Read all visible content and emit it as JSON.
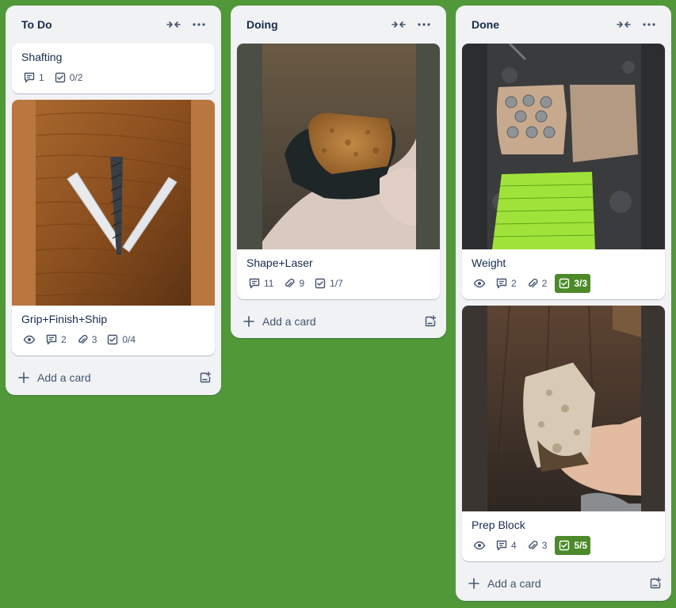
{
  "lists": [
    {
      "title": "To Do",
      "cards": [
        {
          "title": "Shafting",
          "comments": "1",
          "checklist": "0/2"
        },
        {
          "title": "Grip+Finish+Ship",
          "comments": "2",
          "attachments": "3",
          "checklist": "0/4"
        }
      ],
      "add_label": "Add a card"
    },
    {
      "title": "Doing",
      "cards": [
        {
          "title": "Shape+Laser",
          "comments": "11",
          "attachments": "9",
          "checklist": "1/7"
        }
      ],
      "add_label": "Add a card"
    },
    {
      "title": "Done",
      "cards": [
        {
          "title": "Weight",
          "comments": "2",
          "attachments": "2",
          "checklist": "3/3"
        },
        {
          "title": "Prep Block",
          "comments": "4",
          "attachments": "3",
          "checklist": "5/5"
        }
      ],
      "add_label": "Add a card"
    }
  ],
  "colors": {
    "board_background": "#519839",
    "list_background": "#f1f2f4",
    "checklist_complete": "#4c8a2a"
  },
  "icons": [
    "collapse-icon",
    "more-icon",
    "comment-icon",
    "checklist-icon",
    "attachment-icon",
    "watch-icon",
    "plus-icon",
    "card-template-icon"
  ]
}
